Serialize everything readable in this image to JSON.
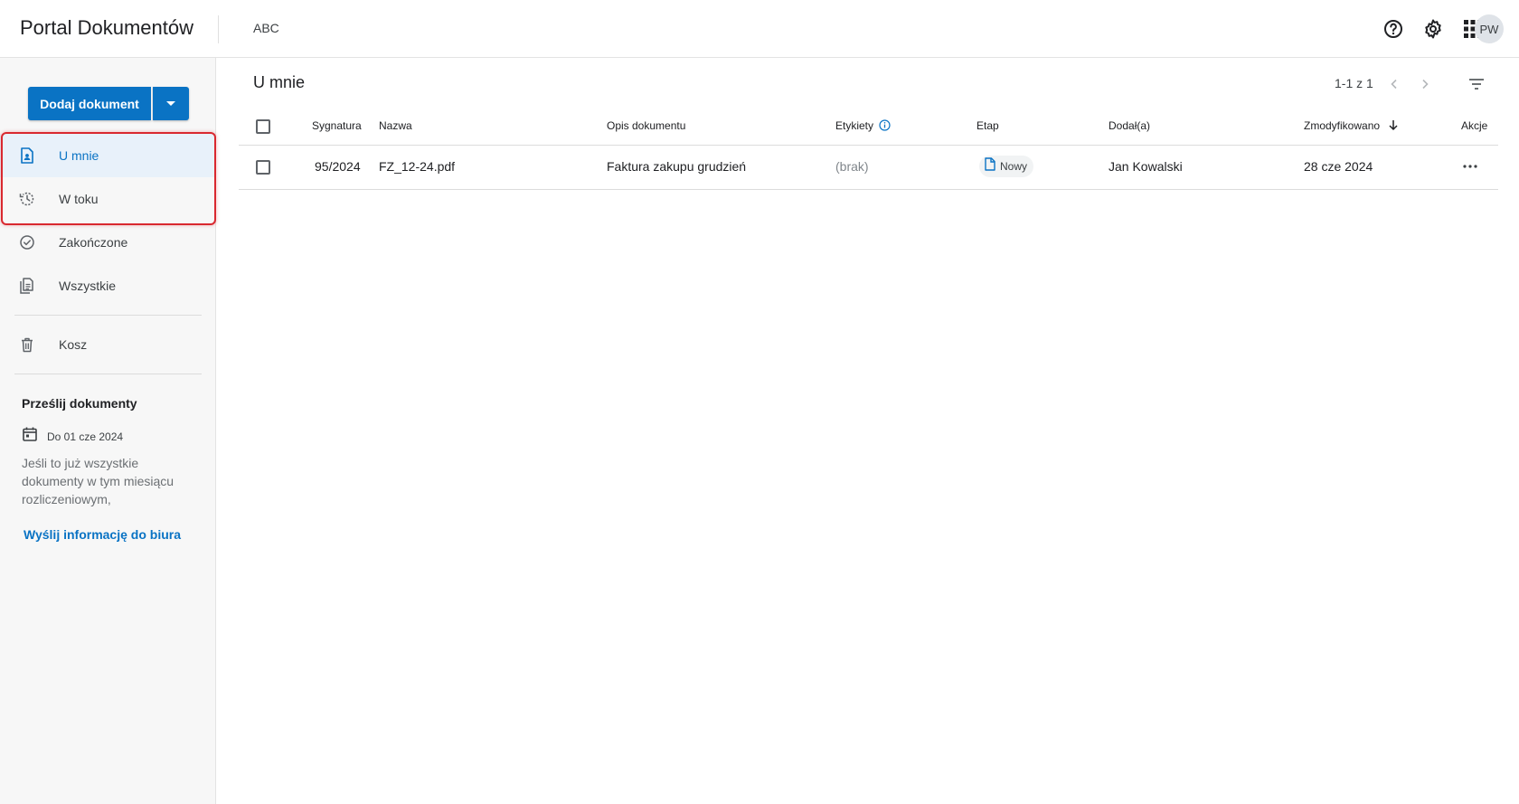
{
  "header": {
    "app_title": "Portal Dokumentów",
    "company": "ABC",
    "icons": [
      "help-icon",
      "gear-icon",
      "apps-grid-icon"
    ],
    "avatar_initials": "PW"
  },
  "sidebar": {
    "add_button_label": "Dodaj dokument",
    "nav_items": [
      {
        "label": "U mnie",
        "icon": "person-document-icon",
        "active": true
      },
      {
        "label": "W toku",
        "icon": "history-clock-icon",
        "active": false
      },
      {
        "label": "Zakończone",
        "icon": "check-circle-icon",
        "active": false
      },
      {
        "label": "Wszystkie",
        "icon": "documents-stack-icon",
        "active": false
      },
      {
        "label": "Kosz",
        "icon": "trash-icon",
        "active": false
      }
    ],
    "send_section": {
      "title": "Prześlij dokumenty",
      "due_date": "Do 01 cze 2024",
      "description": "Jeśli to już wszystkie dokumenty w tym miesiącu rozliczeniowym,",
      "link_label": "Wyślij informację do biura"
    }
  },
  "main": {
    "title": "U mnie",
    "pagination": "1-1 z 1",
    "columns": [
      "Sygnatura",
      "Nazwa",
      "Opis dokumentu",
      "Etykiety",
      "Etap",
      "Dodał(a)",
      "Zmodyfikowano",
      "Akcje"
    ],
    "rows": [
      {
        "signature": "95/2024",
        "name": "FZ_12-24.pdf",
        "description": "Faktura zakupu grudzień",
        "labels": "(brak)",
        "stage": "Nowy",
        "added_by": "Jan Kowalski",
        "modified": "28 cze 2024"
      }
    ]
  },
  "colors": {
    "accent": "#0a73c4",
    "highlight": "#d9282f",
    "active_nav_bg": "#e8f1fa"
  }
}
